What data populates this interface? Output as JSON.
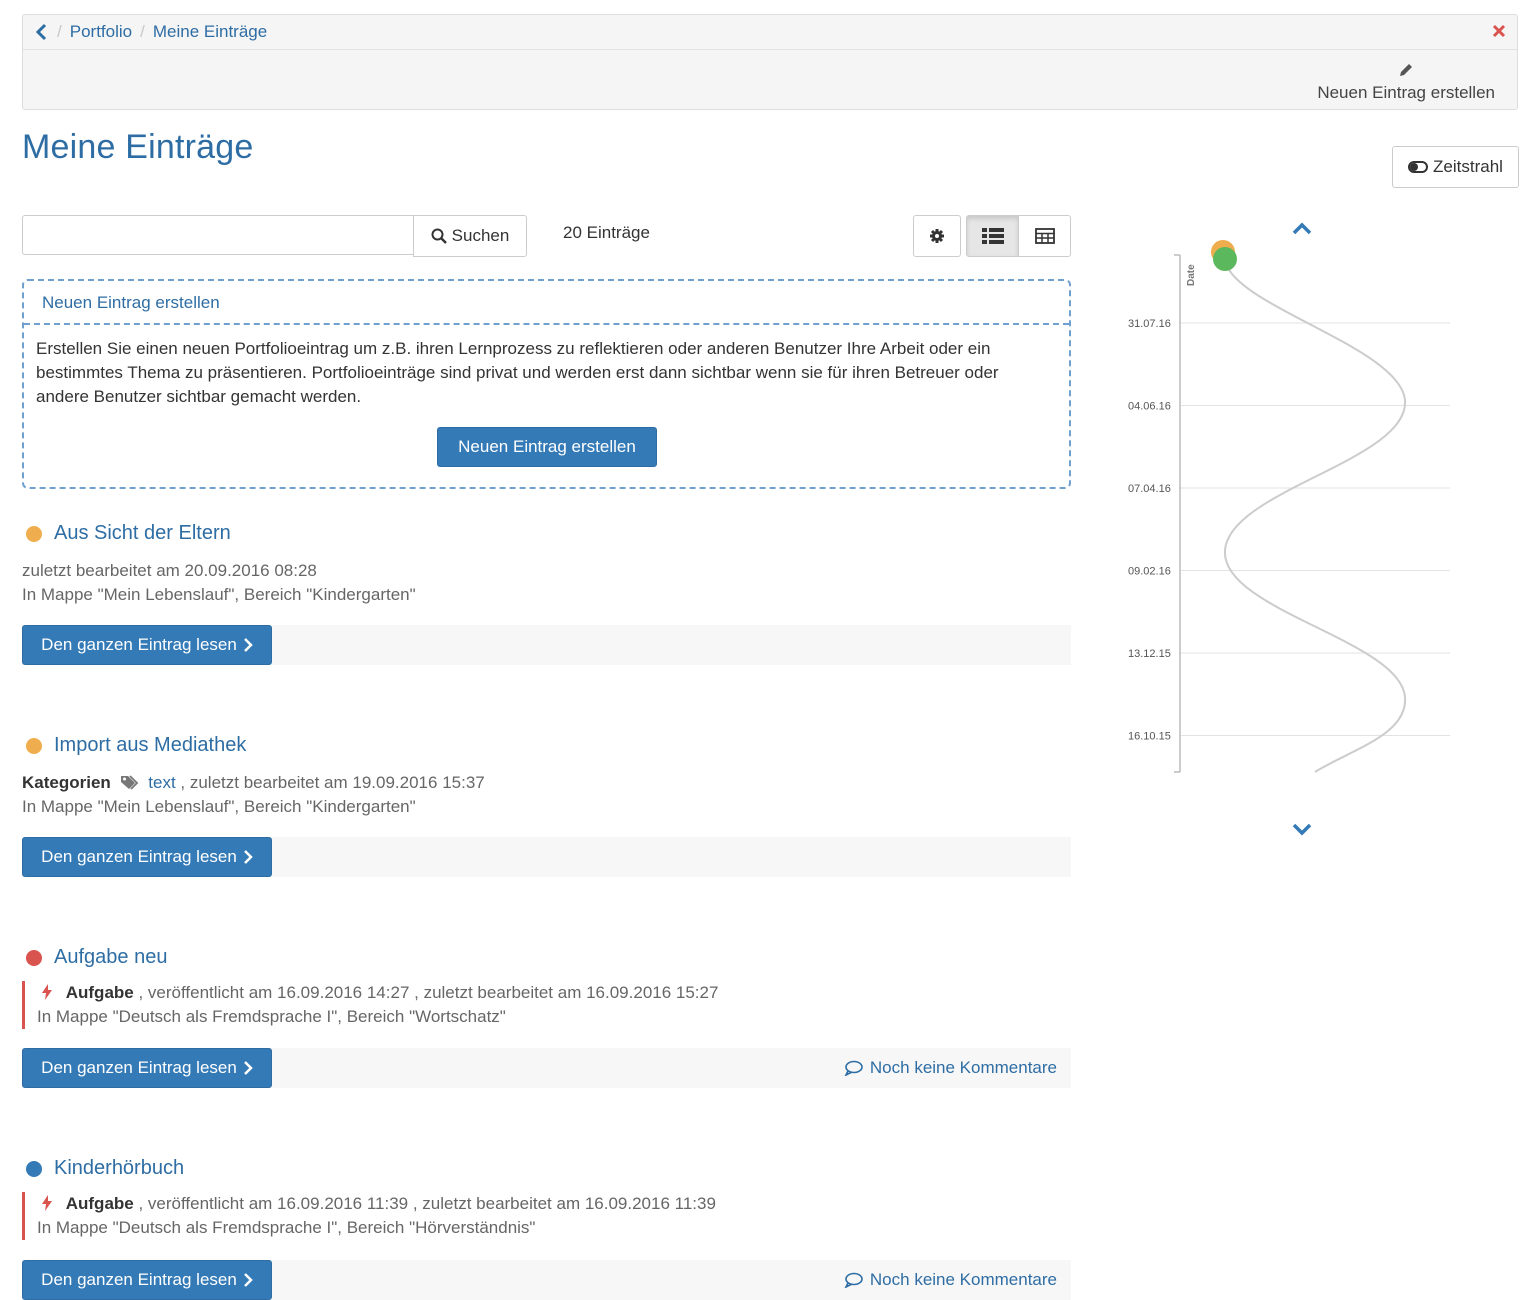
{
  "toolbar": {
    "breadcrumb": [
      "Portfolio",
      "Meine Einträge"
    ],
    "new_entry_label": "Neuen Eintrag erstellen"
  },
  "page": {
    "title": "Meine Einträge",
    "timeline_toggle": "Zeitstrahl"
  },
  "search": {
    "placeholder": "",
    "button": "Suchen",
    "count": "20 Einträge"
  },
  "create_box": {
    "title": "Neuen Eintrag erstellen",
    "text": "Erstellen Sie einen neuen Portfolioeintrag um z.B. ihren Lernprozess zu reflektieren oder anderen Benutzer Ihre Arbeit oder ein bestimmtes Thema zu präsentieren. Portfolioeinträge sind privat und werden erst dann sichtbar wenn sie für ihren Betreuer oder andere Benutzer sichtbar gemacht werden.",
    "button": "Neuen Eintrag erstellen"
  },
  "entries": [
    {
      "title": "Aus Sicht der Eltern",
      "status_color": "#f0ad4e",
      "edited": "zuletzt bearbeitet am 20.09.2016 08:28",
      "location": "In Mappe \"Mein Lebenslauf\", Bereich \"Kindergarten\"",
      "read_label": "Den ganzen Eintrag lesen"
    },
    {
      "title": "Import aus Mediathek",
      "status_color": "#f0ad4e",
      "categories_label": "Kategorien",
      "tag": "text",
      "edited": ", zuletzt bearbeitet am 19.09.2016 15:37",
      "location": "In Mappe \"Mein Lebenslauf\", Bereich \"Kindergarten\"",
      "read_label": "Den ganzen Eintrag lesen"
    },
    {
      "title": "Aufgabe neu",
      "status_color": "#d9534f",
      "assignment_label": "Aufgabe",
      "published": ", veröffentlicht am 16.09.2016 14:27 , zuletzt bearbeitet am 16.09.2016 15:27",
      "location": "In Mappe \"Deutsch als Fremdsprache I\", Bereich \"Wortschatz\"",
      "read_label": "Den ganzen Eintrag lesen",
      "comments": "Noch keine Kommentare"
    },
    {
      "title": "Kinderhörbuch",
      "status_color": "#337ab7",
      "assignment_label": "Aufgabe",
      "published": ", veröffentlicht am 16.09.2016 11:39 , zuletzt bearbeitet am 16.09.2016 11:39",
      "location": "In Mappe \"Deutsch als Fremdsprache I\", Bereich \"Hörverständnis\"",
      "read_label": "Den ganzen Eintrag lesen",
      "comments": "Noch keine Kommentare"
    }
  ],
  "chart_data": {
    "type": "scatter",
    "ylabel": "Date",
    "y_ticks": [
      "31.07.16",
      "04.06.16",
      "07.04.16",
      "09.02.16",
      "13.12.15",
      "16.10.15"
    ],
    "points": [
      {
        "date": "20.09.16",
        "color": "#f0ad4e"
      },
      {
        "date": "16.09.16",
        "color": "#5cb85c"
      }
    ],
    "grid": true
  },
  "colors": {
    "primary": "#337ab7",
    "link": "#2e6da4",
    "close": "#d9534f"
  }
}
